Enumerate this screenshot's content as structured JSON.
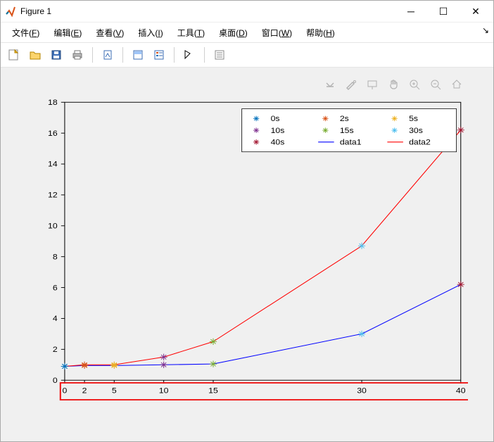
{
  "window": {
    "title": "Figure 1"
  },
  "menu": {
    "file": {
      "label": "文件(",
      "accel": "F",
      "tail": ")"
    },
    "edit": {
      "label": "编辑(",
      "accel": "E",
      "tail": ")"
    },
    "view": {
      "label": "查看(",
      "accel": "V",
      "tail": ")"
    },
    "insert": {
      "label": "插入(",
      "accel": "I",
      "tail": ")"
    },
    "tools": {
      "label": "工具(",
      "accel": "T",
      "tail": ")"
    },
    "desktop": {
      "label": "桌面(",
      "accel": "D",
      "tail": ")"
    },
    "window": {
      "label": "窗口(",
      "accel": "W",
      "tail": ")"
    },
    "help": {
      "label": "帮助(",
      "accel": "H",
      "tail": ")"
    }
  },
  "toolbar": {
    "items": [
      {
        "name": "new-figure-icon"
      },
      {
        "name": "open-icon"
      },
      {
        "name": "save-icon"
      },
      {
        "name": "print-icon"
      },
      {
        "name": "sep"
      },
      {
        "name": "link-icon"
      },
      {
        "name": "sep"
      },
      {
        "name": "data-tip-icon"
      },
      {
        "name": "legend-icon"
      },
      {
        "name": "sep"
      },
      {
        "name": "edit-plot-icon"
      },
      {
        "name": "sep"
      },
      {
        "name": "plot-tools-icon"
      }
    ]
  },
  "axes_toolbar": {
    "items": [
      {
        "name": "export-icon"
      },
      {
        "name": "brush-icon"
      },
      {
        "name": "datatip-icon"
      },
      {
        "name": "pan-icon"
      },
      {
        "name": "zoom-in-icon"
      },
      {
        "name": "zoom-out-icon"
      },
      {
        "name": "home-icon"
      }
    ]
  },
  "chart_data": {
    "type": "line",
    "x": [
      0,
      2,
      5,
      10,
      15,
      30,
      40
    ],
    "xlim": [
      0,
      40
    ],
    "ylim": [
      0,
      18
    ],
    "xticks": [
      0,
      2,
      5,
      10,
      15,
      30,
      40
    ],
    "xtick_labels": [
      "0",
      "2",
      "5",
      "10",
      "15",
      "30",
      "40"
    ],
    "ytick_labels": [
      "0",
      "2",
      "4",
      "6",
      "8",
      "10",
      "12",
      "14",
      "16",
      "18"
    ],
    "series": [
      {
        "name": "data1",
        "kind": "line",
        "color": "#0000ff",
        "values": [
          0.9,
          0.95,
          0.95,
          1.0,
          1.05,
          3.0,
          6.2
        ]
      },
      {
        "name": "data2",
        "kind": "line",
        "color": "#ff0000",
        "values": [
          0.9,
          1.0,
          1.0,
          1.5,
          2.5,
          8.7,
          16.2
        ]
      }
    ],
    "scatter_points": [
      {
        "name": "0s",
        "color": "#0072bd",
        "x": 0,
        "y1": 0.9,
        "y2": 0.9
      },
      {
        "name": "2s",
        "color": "#d95319",
        "x": 2,
        "y1": 0.95,
        "y2": 1.0
      },
      {
        "name": "5s",
        "color": "#edb120",
        "x": 5,
        "y1": 0.95,
        "y2": 1.0
      },
      {
        "name": "10s",
        "color": "#7e2f8e",
        "x": 10,
        "y1": 1.0,
        "y2": 1.5
      },
      {
        "name": "15s",
        "color": "#77ac30",
        "x": 15,
        "y1": 1.05,
        "y2": 2.5
      },
      {
        "name": "30s",
        "color": "#4dbeee",
        "x": 30,
        "y1": 3.0,
        "y2": 8.7
      },
      {
        "name": "40s",
        "color": "#a2142f",
        "x": 40,
        "y1": 6.2,
        "y2": 16.2
      }
    ],
    "legend": {
      "columns": 3,
      "entries": [
        {
          "label": "0s",
          "kind": "marker",
          "color": "#0072bd"
        },
        {
          "label": "2s",
          "kind": "marker",
          "color": "#d95319"
        },
        {
          "label": "5s",
          "kind": "marker",
          "color": "#edb120"
        },
        {
          "label": "10s",
          "kind": "marker",
          "color": "#7e2f8e"
        },
        {
          "label": "15s",
          "kind": "marker",
          "color": "#77ac30"
        },
        {
          "label": "30s",
          "kind": "marker",
          "color": "#4dbeee"
        },
        {
          "label": "40s",
          "kind": "marker",
          "color": "#a2142f"
        },
        {
          "label": "data1",
          "kind": "line",
          "color": "#0000ff"
        },
        {
          "label": "data2",
          "kind": "line",
          "color": "#ff0000"
        }
      ]
    }
  }
}
